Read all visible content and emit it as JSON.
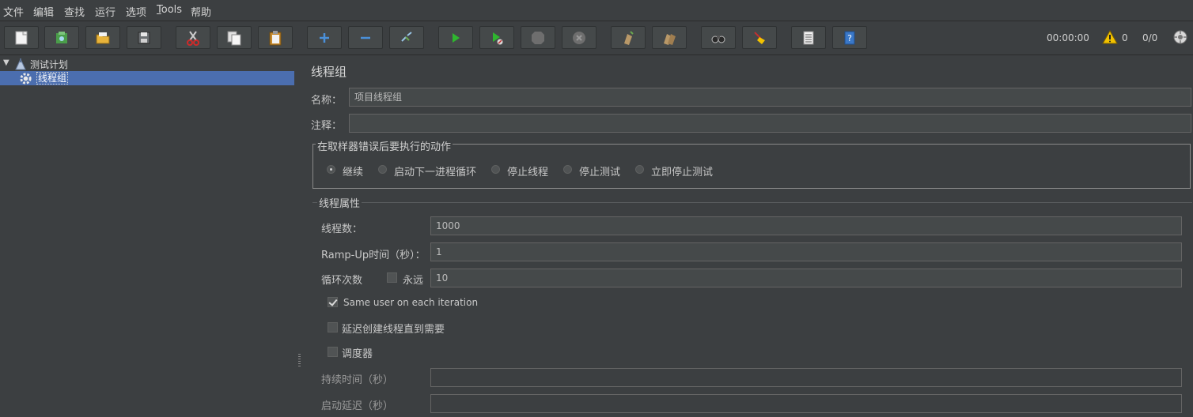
{
  "menu": [
    {
      "label": "文件"
    },
    {
      "label": "编辑"
    },
    {
      "label": "查找"
    },
    {
      "label": "运行"
    },
    {
      "label": "选项"
    },
    {
      "label": "Tools",
      "mnemonic": "T",
      "rest": "ools"
    },
    {
      "label": "帮助"
    }
  ],
  "toolbar": {
    "buttons": [
      "new-icon",
      "templates-icon",
      "open-icon",
      "save-icon",
      "cut-icon",
      "copy-icon",
      "paste-icon",
      "expand-icon",
      "collapse-icon",
      "toggle-icon",
      "start-icon",
      "start-no-pause-icon",
      "stop-icon",
      "shutdown-icon",
      "clear-icon",
      "clear-all-icon",
      "search-icon",
      "reset-search-icon",
      "function-helper-icon",
      "help-icon"
    ]
  },
  "status": {
    "elapsed": "00:00:00",
    "warnings": "0",
    "threads": "0/0"
  },
  "tree": {
    "root": "测试计划",
    "child": "线程组"
  },
  "panel": {
    "title": "线程组",
    "name_label": "名称：",
    "name_value": "项目线程组",
    "comment_label": "注释：",
    "comment_value": "",
    "error_action": {
      "legend": "在取样器错误后要执行的动作",
      "options": [
        "继续",
        "启动下一进程循环",
        "停止线程",
        "停止测试",
        "立即停止测试"
      ],
      "selected": "继续"
    },
    "thread_props": {
      "legend": "线程属性",
      "threads_label": "线程数：",
      "threads_value": "1000",
      "rampup_label": "Ramp-Up时间（秒）：",
      "rampup_value": "1",
      "loop_label": "循环次数",
      "forever_label": "永远",
      "forever_checked": false,
      "loop_value": "10",
      "same_user_label": "Same user on each iteration",
      "same_user_checked": true,
      "delay_label": "延迟创建线程直到需要",
      "delay_checked": false,
      "scheduler_label": "调度器",
      "scheduler_checked": false,
      "duration_label": "持续时间（秒）",
      "duration_value": "",
      "startup_label": "启动延迟（秒）",
      "startup_value": ""
    }
  },
  "colors": {
    "bg": "#3c3f41",
    "selection": "#4b6eaf",
    "field": "#45494a",
    "warning": "#f2c200",
    "run": "#2fb52f",
    "cut": "#d02a2a"
  }
}
